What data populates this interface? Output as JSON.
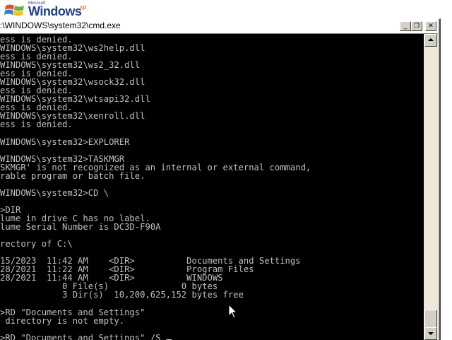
{
  "desktop": {
    "logo_microsoft": "Microsoft",
    "logo_windows": "Windows",
    "logo_xp": "xp"
  },
  "window": {
    "title": ":\\WINDOWS\\system32\\cmd.exe",
    "buttons": {
      "minimize": "_",
      "maximize": "❐",
      "close": "✕"
    }
  },
  "console": {
    "lines": [
      "ess is denied.",
      "WINDOWS\\system32\\ws2help.dll",
      "ess is denied.",
      "WINDOWS\\system32\\ws2_32.dll",
      "ess is denied.",
      "WINDOWS\\system32\\wsock32.dll",
      "ess is denied.",
      "WINDOWS\\system32\\wtsapi32.dll",
      "ess is denied.",
      "WINDOWS\\system32\\xenroll.dll",
      "ess is denied.",
      "",
      "WINDOWS\\system32>EXPLORER",
      "",
      "WINDOWS\\system32>TASKMGR",
      "SKMGR' is not recognized as an internal or external command,",
      "rable program or batch file.",
      "",
      "WINDOWS\\system32>CD \\",
      "",
      ">DIR",
      "lume in drive C has no label.",
      "lume Serial Number is DC3D-F90A",
      "",
      "rectory of C:\\",
      "",
      "15/2023  11:42 AM    <DIR>          Documents and Settings",
      "28/2021  11:22 AM    <DIR>          Program Files",
      "28/2021  11:44 AM    <DIR>          WINDOWS",
      "            0 File(s)              0 bytes",
      "            3 Dir(s)  10,200,625,152 bytes free",
      "",
      ">RD \"Documents and Settings\"",
      " directory is not empty.",
      "",
      ">RD \"Documents and Settings\" /S "
    ]
  },
  "colors": {
    "console_bg": "#000000",
    "console_fg": "#c0c0c0",
    "chrome": "#d4d0c8"
  }
}
